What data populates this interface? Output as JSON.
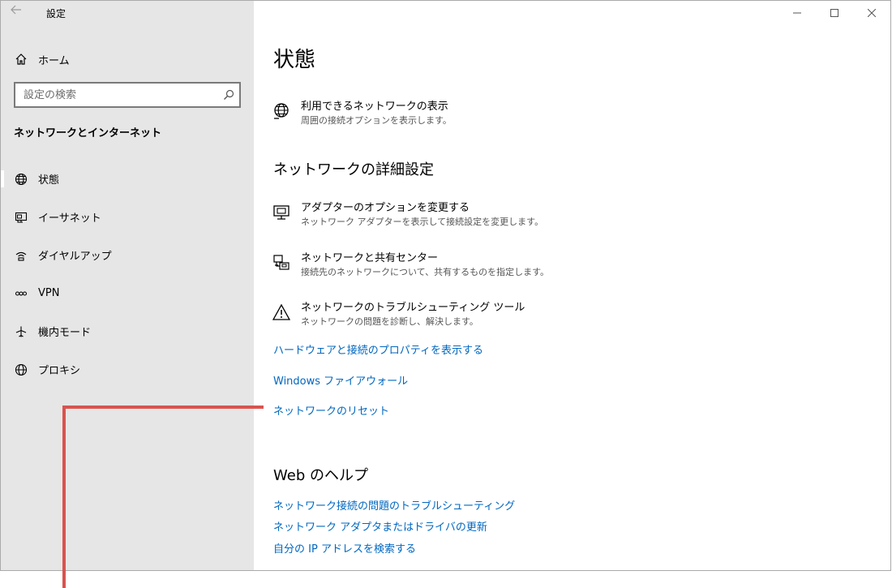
{
  "window": {
    "title": "設定"
  },
  "sidebar": {
    "home_label": "ホーム",
    "search_placeholder": "設定の検索",
    "section_title": "ネットワークとインターネット",
    "items": [
      {
        "label": "状態",
        "icon": "globe-icon"
      },
      {
        "label": "イーサネット",
        "icon": "ethernet-icon"
      },
      {
        "label": "ダイヤルアップ",
        "icon": "dialup-icon"
      },
      {
        "label": "VPN",
        "icon": "vpn-icon"
      },
      {
        "label": "機内モード",
        "icon": "airplane-icon"
      },
      {
        "label": "プロキシ",
        "icon": "proxy-globe-icon"
      }
    ]
  },
  "main": {
    "title": "状態",
    "show_networks": {
      "title": "利用できるネットワークの表示",
      "desc": "周囲の接続オプションを表示します。"
    },
    "advanced_heading": "ネットワークの詳細設定",
    "advanced": [
      {
        "title": "アダプターのオプションを変更する",
        "desc": "ネットワーク アダプターを表示して接続設定を変更します。"
      },
      {
        "title": "ネットワークと共有センター",
        "desc": "接続先のネットワークについて、共有するものを指定します。"
      },
      {
        "title": "ネットワークのトラブルシューティング ツール",
        "desc": "ネットワークの問題を診断し、解決します。"
      }
    ],
    "links": {
      "hardware_properties": "ハードウェアと接続のプロパティを表示する",
      "firewall": "Windows ファイアウォール",
      "network_reset": "ネットワークのリセット"
    },
    "help_heading": "Web のヘルプ",
    "help_links": [
      "ネットワーク接続の問題のトラブルシューティング",
      "ネットワーク アダプタまたはドライバの更新",
      "自分の IP アドレスを検索する"
    ]
  },
  "colors": {
    "sidebar_bg": "#e6e6e6",
    "link": "#0067c0",
    "callout": "#d9534f"
  }
}
